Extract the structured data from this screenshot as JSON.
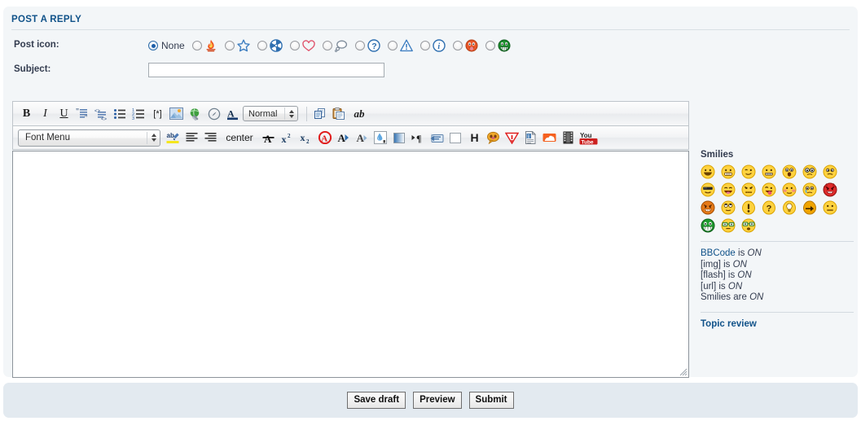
{
  "panel": {
    "title": "POST A REPLY"
  },
  "fields": {
    "post_icon_label": "Post icon:",
    "subject_label": "Subject:",
    "subject_value": "",
    "subject_placeholder": "",
    "message_value": "",
    "message_placeholder": ""
  },
  "post_icons": [
    {
      "name": "none",
      "label": "None",
      "checked": true
    },
    {
      "name": "flame-icon",
      "label": "",
      "checked": false
    },
    {
      "name": "star-icon",
      "label": "",
      "checked": false
    },
    {
      "name": "radioactive-icon",
      "label": "",
      "checked": false
    },
    {
      "name": "heart-icon",
      "label": "",
      "checked": false
    },
    {
      "name": "thought-bubble-icon",
      "label": "",
      "checked": false
    },
    {
      "name": "question-mark-icon",
      "label": "",
      "checked": false
    },
    {
      "name": "warning-triangle-icon",
      "label": "",
      "checked": false
    },
    {
      "name": "info-icon",
      "label": "",
      "checked": false
    },
    {
      "name": "tongue-smiley-icon",
      "label": "",
      "checked": false
    },
    {
      "name": "grin-smiley-icon",
      "label": "",
      "checked": false
    }
  ],
  "toolbar_row1": {
    "bold": "B",
    "italic": "I",
    "underline": "U",
    "quote": "quote-icon",
    "code": "code-icon",
    "unordered_list": "bullet-list-icon",
    "ordered_list": "numbered-list-icon",
    "list_item": "[*]",
    "image": "image-icon",
    "url": "link-globe-icon",
    "flash": "flash-icon",
    "font_color": "font-color-icon",
    "size_select": "Normal",
    "copy": "copy-icon",
    "paste": "paste-icon",
    "spellcheck": "ab"
  },
  "toolbar_row2": {
    "font_menu": "Font Menu",
    "highlight": "highlight-icon",
    "align_left": "align-left-icon",
    "align_right": "align-right-icon",
    "align_center": "center",
    "strike": "strikethrough-icon",
    "superscript": "superscript-icon",
    "subscript": "subscript-icon",
    "color_red": "color-red-icon",
    "color_blue": "color-blue-icon",
    "color_grey": "color-grey-icon",
    "color_picker": "color-dropper-icon",
    "gradient": "gradient-icon",
    "indent": "indent-icon",
    "marquee": "marquee-icon",
    "blank": "blank-box-icon",
    "heading": "H",
    "comment": "comment-bubble-icon",
    "spoiler": "spoiler-warning-icon",
    "info_page": "info-page-icon",
    "soundcloud": "soundcloud-icon",
    "film": "film-strip-icon",
    "youtube": "youtube-icon"
  },
  "sidebar": {
    "smilies_heading": "Smilies",
    "smilies": [
      "smiley-laugh",
      "smiley-grin",
      "smiley-wink",
      "smiley-zip",
      "smiley-shock",
      "smiley-eek",
      "smiley-confused",
      "smiley-cool",
      "smiley-lol",
      "smiley-mad",
      "smiley-razz",
      "smiley-redface",
      "smiley-cry",
      "smiley-evil",
      "smiley-twisted",
      "smiley-roll",
      "smiley-exclaim",
      "smiley-question",
      "smiley-idea",
      "smiley-arrow",
      "smiley-neutral",
      "smiley-mrgreen",
      "smiley-geek",
      "smiley-ugeek"
    ],
    "bbcode_info": [
      {
        "name": "BBCode",
        "link": true,
        "verb": "is",
        "state": "ON"
      },
      {
        "name": "[img]",
        "link": false,
        "verb": "is",
        "state": "ON"
      },
      {
        "name": "[flash]",
        "link": false,
        "verb": "is",
        "state": "ON"
      },
      {
        "name": "[url]",
        "link": false,
        "verb": "is",
        "state": "ON"
      },
      {
        "name": "Smilies",
        "link": false,
        "verb": "are",
        "state": "ON"
      }
    ],
    "topic_review": "Topic review"
  },
  "buttons": {
    "save_draft": "Save draft",
    "preview": "Preview",
    "submit": "Submit"
  },
  "colors": {
    "panel_bg": "#f3f6f8",
    "bottom_bg": "#e3eaf0",
    "heading_blue": "#105289",
    "text_dark": "#333c4f",
    "border": "#bfc5cb"
  }
}
